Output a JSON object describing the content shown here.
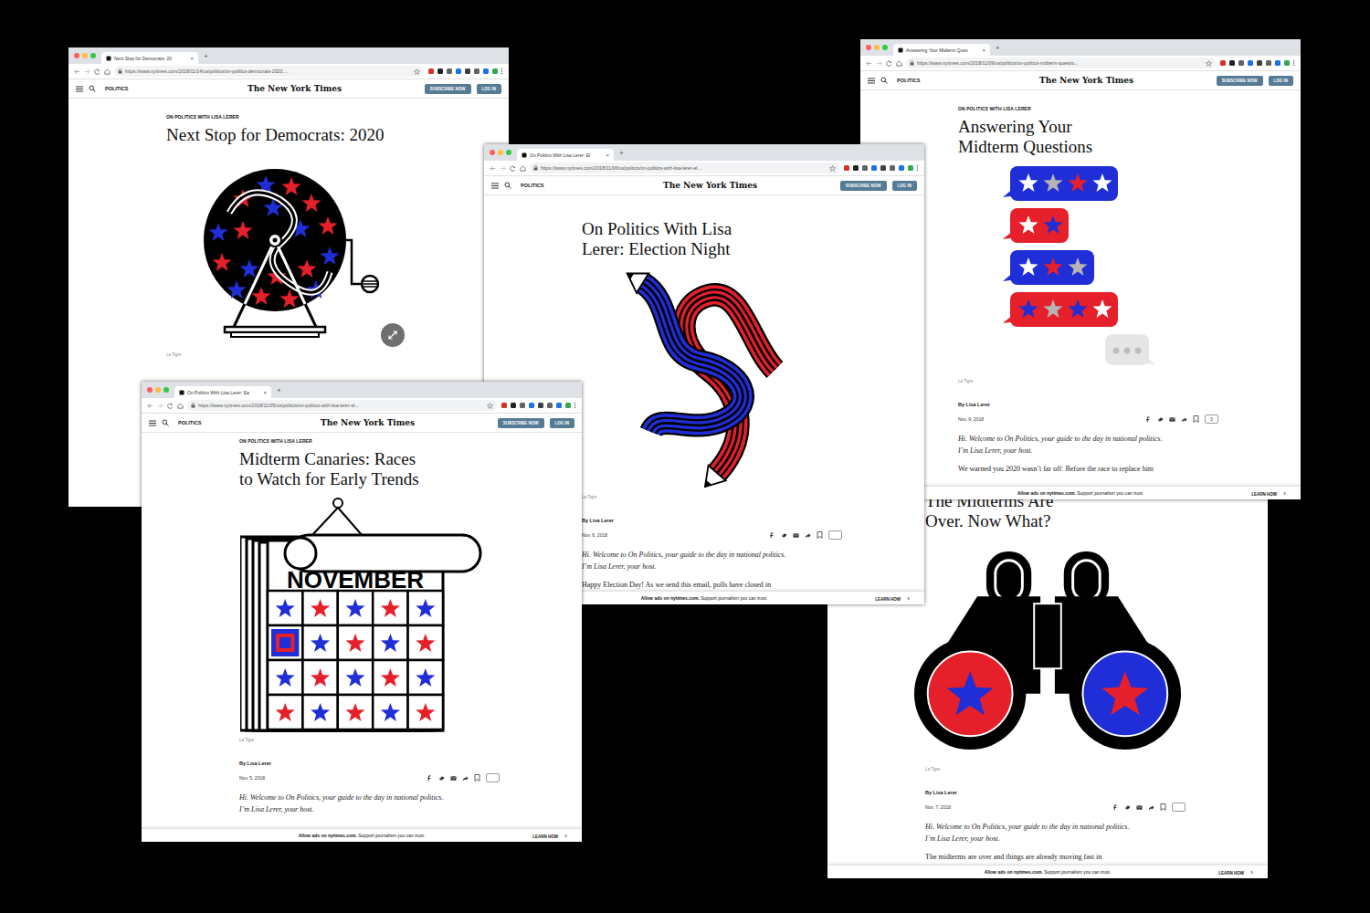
{
  "site": {
    "section": "POLITICS",
    "logo": "The New York Times",
    "subscribe": "SUBSCRIBE NOW",
    "login": "LOG IN"
  },
  "browser": {
    "tab_close": "×",
    "new_tab": "+"
  },
  "banner": {
    "lead": "Allow ads on nytimes.com.",
    "text": "Support journalism you can trust.",
    "link": "LEARN HOW",
    "chevron": "›"
  },
  "windows": [
    {
      "tab_title": "Next Stop for Democrats: 20",
      "url": "https://www.nytimes.com/2018/11/14/us/politics/on-politics-democrats-2020....",
      "kicker": "ON POLITICS WITH LISA LERER",
      "headline": [
        "Next Stop for Democrats: 2020"
      ],
      "art": "lottery",
      "credit": "La Tigre",
      "zoom": true
    },
    {
      "headline": [
        "The Midterms Are",
        "Over. Now What?"
      ],
      "art": "binoculars",
      "credit": "La Tigre",
      "byline": "By Lisa Lerer",
      "date": "Nov. 7, 2018",
      "comments": "",
      "intro": [
        "Hi. Welcome to On Politics, your guide to the day in national politics.",
        "I’m Lisa Lerer, your host."
      ],
      "paragraph": "The midterms are over and things are already moving fast in",
      "zoom": false
    },
    {
      "tab_title": "Answering Your Midterm Ques",
      "url": "https://www.nytimes.com/2018/11/09/us/politics/on-politics-midterm-questio...",
      "kicker": "ON POLITICS WITH LISA LERER",
      "headline": [
        "Answering Your",
        "Midterm Questions"
      ],
      "art": "chat",
      "credit": "La Tigre",
      "byline": "By Lisa Lerer",
      "date": "Nov. 9, 2018",
      "comments": "3",
      "intro": [
        "Hi. Welcome to On Politics, your guide to the day in national politics.",
        "I’m Lisa Lerer, your host."
      ],
      "paragraph": "We warned you 2020 wasn’t far off: Before the race to replace him",
      "zoom": false
    },
    {
      "tab_title": "On Politics With Lisa Lerer: El",
      "url": "https://www.nytimes.com/2018/11/06/us/politics/on-politics-with-lisa-lerer-el...",
      "headline": [
        "On Politics With Lisa",
        "Lerer: Election Night"
      ],
      "art": "pencils",
      "credit": "La Tigre",
      "byline": "By Lisa Lerer",
      "date": "Nov. 6, 2018",
      "comments": "",
      "intro": [
        "Hi. Welcome to On Politics, your guide to the day in national politics.",
        "I’m Lisa Lerer, your host."
      ],
      "paragraph": "Happy Election Day! As we send this email, polls have closed in",
      "zoom": false
    },
    {
      "tab_title": "On Politics With Lisa Lerer: Ea",
      "url": "https://www.nytimes.com/2018/11/05/us/politics/on-politics-with-lisa-lerer-el...",
      "kicker": "ON POLITICS WITH LISA LERER",
      "headline": [
        "Midterm Canaries: Races",
        "to Watch for Early Trends"
      ],
      "art": "calendar",
      "art_text": "NOVEMBER",
      "credit": "La Tigre",
      "byline": "By Lisa Lerer",
      "date": "Nov. 5, 2018",
      "comments": "",
      "intro": [
        "Hi. Welcome to On Politics, your guide to the day in national politics.",
        "I’m Lisa Lerer, your host."
      ],
      "zoom": false
    }
  ]
}
